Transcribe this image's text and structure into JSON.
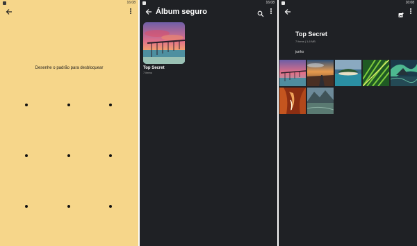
{
  "status": {
    "time": "16:08"
  },
  "lock_screen": {
    "prompt": "Desenhe o padrão para desbloquear",
    "pattern_dots": 9
  },
  "album_list": {
    "title": "Álbum seguro",
    "albums": [
      {
        "name": "Top Secret",
        "count": "7 items"
      }
    ]
  },
  "album_view": {
    "title": "Top Secret",
    "meta": "7 items | 1,6 MB",
    "month": "junho",
    "photos": [
      "pier-sunset",
      "desert-road-sunset",
      "tropical-island",
      "palm-leaf",
      "aurora-lake",
      "canyon-slot",
      "mountain-lake"
    ]
  },
  "colors": {
    "lock_background": "#f6d68a",
    "dark_background": "#1f2125"
  }
}
